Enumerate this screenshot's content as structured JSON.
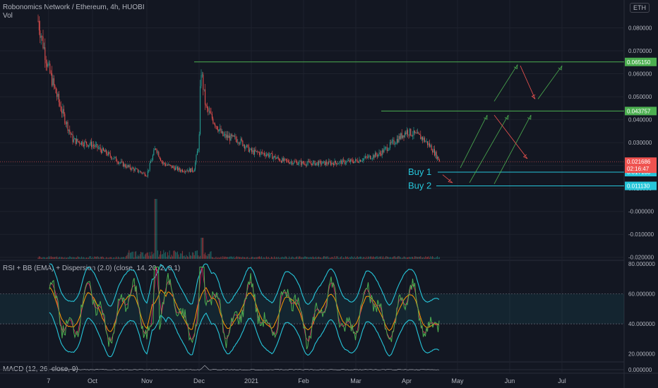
{
  "header": {
    "title": "Robonomics Network / Ethereum, 4h, HUOBI",
    "vol_label": "Vol",
    "currency_badge": "ETH",
    "rsi_title": "RSI + BB (EMA) + Dispersion (2.0) (close, 14, 20, 2, 0.1)",
    "macd_title": "MACD (12, 26, close, 9)"
  },
  "colors": {
    "background": "#131722",
    "up": "#26a69a",
    "down": "#ef5350",
    "green_line": "#4caf50",
    "cyan_line": "#26c6da",
    "grid": "#1e222d"
  },
  "chart_data": [
    {
      "type": "line",
      "panel": "price",
      "x_ticks": [
        "7",
        "Oct",
        "Nov",
        "Dec",
        "2021",
        "Feb",
        "Mar",
        "Apr",
        "May",
        "Jun",
        "Jul"
      ],
      "y_ticks": [
        "0.080000",
        "0.070000",
        "0.060000",
        "0.050000",
        "0.040000",
        "0.030000",
        "0.020000",
        "0.010000",
        "-0.000000",
        "-0.010000",
        "-0.020000"
      ],
      "ylim": [
        -0.021,
        0.086
      ],
      "price_points": [
        [
          "Sep 1",
          0.083
        ],
        [
          "Sep 7",
          0.062
        ],
        [
          "Sep 14",
          0.045
        ],
        [
          "Sep 21",
          0.031
        ],
        [
          "Oct 1",
          0.029
        ],
        [
          "Oct 10",
          0.025
        ],
        [
          "Oct 20",
          0.02
        ],
        [
          "Nov 1",
          0.016
        ],
        [
          "Nov 6",
          0.028
        ],
        [
          "Nov 10",
          0.021
        ],
        [
          "Nov 20",
          0.018
        ],
        [
          "Nov 28",
          0.018
        ],
        [
          "Dec 1",
          0.03
        ],
        [
          "Dec 2",
          0.063
        ],
        [
          "Dec 5",
          0.045
        ],
        [
          "Dec 15",
          0.033
        ],
        [
          "Dec 25",
          0.031
        ],
        [
          "Jan 1",
          0.026
        ],
        [
          "Jan 10",
          0.025
        ],
        [
          "Jan 20",
          0.022
        ],
        [
          "Feb 1",
          0.021
        ],
        [
          "Feb 15",
          0.021
        ],
        [
          "Mar 1",
          0.022
        ],
        [
          "Mar 15",
          0.025
        ],
        [
          "Mar 25",
          0.031
        ],
        [
          "Apr 1",
          0.035
        ],
        [
          "Apr 10",
          0.032
        ],
        [
          "Apr 15",
          0.028
        ],
        [
          "Apr 20",
          0.0219
        ]
      ],
      "levels": [
        {
          "value": 0.06515,
          "label": "0.065150",
          "color": "#4caf50"
        },
        {
          "value": 0.043757,
          "label": "0.043757",
          "color": "#4caf50"
        },
        {
          "value": 0.01713,
          "label": "0.017130",
          "color": "#26c6da",
          "annotation": "Buy 1"
        },
        {
          "value": 0.01113,
          "label": "0.011130",
          "color": "#26c6da",
          "annotation": "Buy 2"
        }
      ],
      "current_price": {
        "value": 0.021686,
        "label": "0.021686",
        "countdown": "02:16:47"
      }
    },
    {
      "type": "line",
      "panel": "rsi",
      "y_ticks": [
        "80.000000",
        "60.000000",
        "40.000000",
        "20.000000"
      ],
      "ylim": [
        15,
        82
      ],
      "band": [
        40,
        60
      ]
    },
    {
      "type": "line",
      "panel": "macd",
      "y_ticks": [
        "0.000000"
      ]
    }
  ]
}
